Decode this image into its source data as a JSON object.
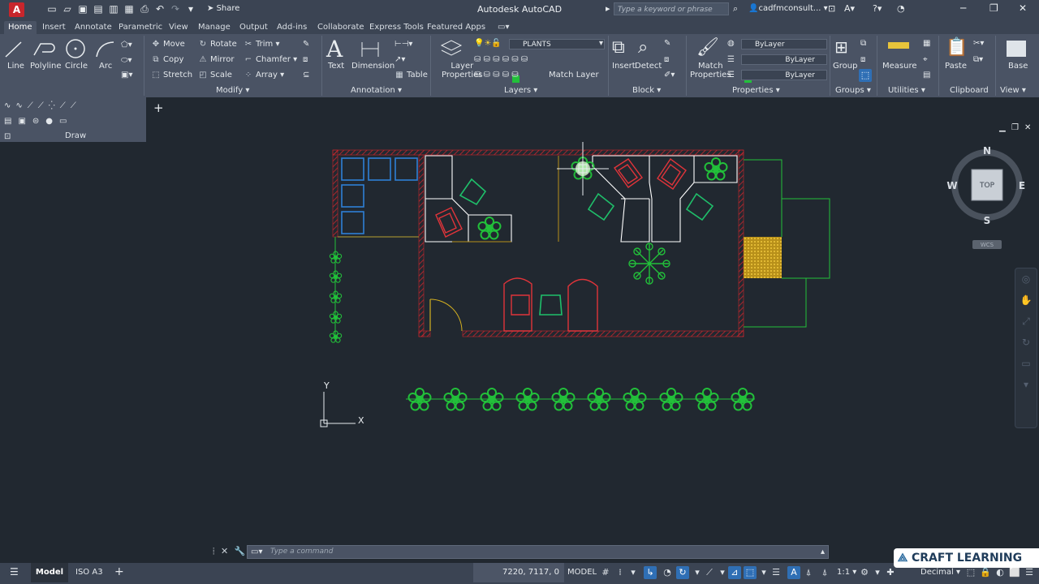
{
  "titlebar": {
    "app_badge": "A",
    "share_label": "Share",
    "title": "Autodesk AutoCAD",
    "search_placeholder": "Type a keyword or phrase",
    "user": "cadfmconsult..."
  },
  "tabs": [
    "Home",
    "Insert",
    "Annotate",
    "Parametric",
    "View",
    "Manage",
    "Output",
    "Add-ins",
    "Collaborate",
    "Express Tools",
    "Featured Apps"
  ],
  "ribbon": {
    "draw_tools": [
      "Line",
      "Polyline",
      "Circle",
      "Arc"
    ],
    "draw_panel_label": "Draw",
    "modify": {
      "col1": [
        "Move",
        "Copy",
        "Stretch"
      ],
      "col2": [
        "Rotate",
        "Mirror",
        "Scale"
      ],
      "col3": [
        "Trim",
        "Chamfer",
        "Array"
      ],
      "label": "Modify"
    },
    "annotation": {
      "text": "Text",
      "dimension": "Dimension",
      "table": "Table",
      "label": "Annotation"
    },
    "layers": {
      "layer_properties_line1": "Layer",
      "layer_properties_line2": "Properties",
      "current_layer": "PLANTS",
      "match_layer": "Match Layer",
      "label": "Layers"
    },
    "block": {
      "insert": "Insert",
      "detect": "Detect",
      "label": "Block"
    },
    "properties": {
      "match_line1": "Match",
      "match_line2": "Properties",
      "bylayer_color": "ByLayer",
      "bylayer_linetype": "ByLayer",
      "bylayer_lineweight": "ByLayer",
      "label": "Properties"
    },
    "groups": {
      "group": "Group",
      "label": "Groups"
    },
    "utilities": {
      "measure": "Measure",
      "label": "Utilities"
    },
    "clipboard": {
      "paste": "Paste",
      "label": "Clipboard"
    },
    "view": {
      "base": "Base",
      "label": "View"
    }
  },
  "viewcube": {
    "north": "N",
    "south": "S",
    "east": "E",
    "west": "W",
    "face": "TOP",
    "ucs": "WCS"
  },
  "ucs_icon": {
    "x": "X",
    "y": "Y"
  },
  "command": {
    "placeholder": "Type a command"
  },
  "status": {
    "model_tab": "Model",
    "layout_tab": "ISO A3",
    "coords": "7220, 7117, 0",
    "space": "MODEL",
    "scale": "1:1",
    "units": "Decimal"
  },
  "watermark": "CRAFT LEARNING",
  "colors": {
    "accent": "#2f6fb5",
    "plants": "#22c03a",
    "walls": "#c8262c",
    "furniture_red": "#e0343a",
    "chairs": "#1fbf6a",
    "tables": "#ffffff",
    "storage": "#2e7fd6"
  }
}
